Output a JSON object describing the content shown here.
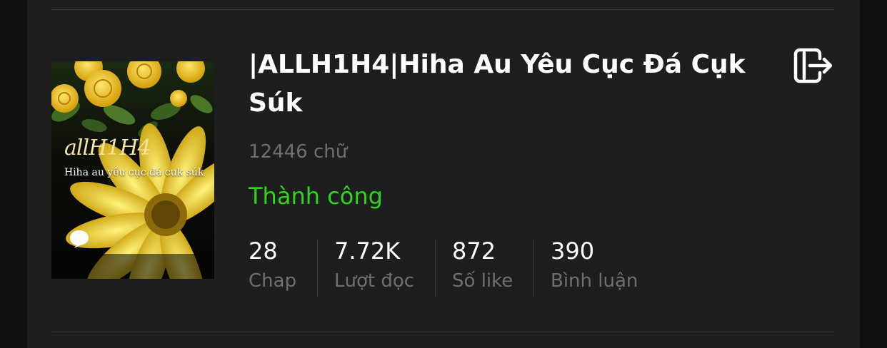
{
  "story": {
    "title": "|ALLH1H4|Hiha Au Yêu Cục Đá Cụk Súk",
    "word_count": "12446 chữ",
    "status": "Thành công",
    "cover": {
      "title_stylized": "allH1H4",
      "subtitle": "Hiha au yêu cục đá cuk súk"
    },
    "stats": [
      {
        "value": "28",
        "label": "Chap"
      },
      {
        "value": "7.72K",
        "label": "Lượt đọc"
      },
      {
        "value": "872",
        "label": "Số like"
      },
      {
        "value": "390",
        "label": "Bình luận"
      }
    ]
  },
  "icons": {
    "exit": "exit-icon",
    "cover_comment": "comment-bubble-icon"
  },
  "colors": {
    "background": "#1e1e1e",
    "title": "#ffffff",
    "muted": "#6e6e6e",
    "status_success": "#2fd51d"
  }
}
